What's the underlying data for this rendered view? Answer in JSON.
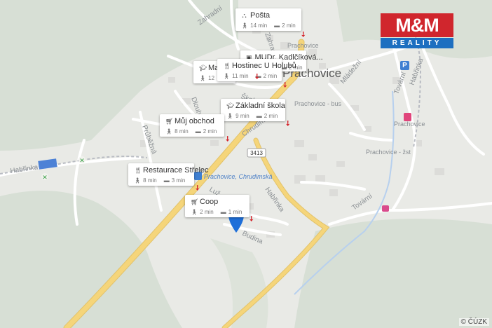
{
  "town_name": "Prachovice",
  "road_number": "3413",
  "street_labels": {
    "zahradni": "Zahradní",
    "skolni": "Školní",
    "dlouha": "Dlouhá",
    "pribuzna": "Průběžná",
    "chrudimska": "Chrudimská",
    "habrinka_w": "Habřinka",
    "habrinka_e": "Habřinka",
    "mladezni": "Mládežní",
    "tovarni_n": "Tovární",
    "tovarni_s": "Tovární",
    "luz": "Luž",
    "zahradni_lower": "Zahradní"
  },
  "place_labels": {
    "prachovice_station": "Prachovice",
    "prachovice_zst": "Prachovice - žst",
    "prachovice_bus_top": "Prachovice",
    "prachovice_bus_skola": "Prachovice - bus",
    "bus_stop_chrudimska": "Prachovice, Chrudimská",
    "habrinka_place": "Habřinka",
    "budina": "Budina"
  },
  "pois": [
    {
      "name": "Pošta",
      "icon": "post-icon",
      "walk": "14 min",
      "drive": "2 min"
    },
    {
      "name": "MUDr. Kadlčíková...",
      "icon": "medical-icon",
      "walk": "",
      "drive": "2 min"
    },
    {
      "name": "Hostinec U Holubů",
      "icon": "restaurant-icon",
      "walk": "11 min",
      "drive": "2 min"
    },
    {
      "name": "Mate...",
      "icon": "school-icon",
      "walk": "12",
      "drive": ""
    },
    {
      "name": "Základní škola",
      "icon": "school-icon",
      "walk": "9 min",
      "drive": "2 min"
    },
    {
      "name": "Můj obchod",
      "icon": "shop-icon",
      "walk": "8 min",
      "drive": "2 min"
    },
    {
      "name": "Restaurace Střelec",
      "icon": "restaurant-icon",
      "walk": "8 min",
      "drive": "3 min"
    },
    {
      "name": "Coop",
      "icon": "shop-icon",
      "walk": "2 min",
      "drive": "1 min"
    }
  ],
  "logo": {
    "top": "M&M",
    "bottom": "REALITY"
  },
  "parking_symbol": "P",
  "copyright": "© ČÚZK",
  "colors": {
    "road_yellow": "#f5d57a",
    "pin_blue": "#1e6fd9",
    "arrow_red": "#d3262d",
    "logo_red": "#d0262d",
    "logo_blue": "#1d6fc0"
  }
}
